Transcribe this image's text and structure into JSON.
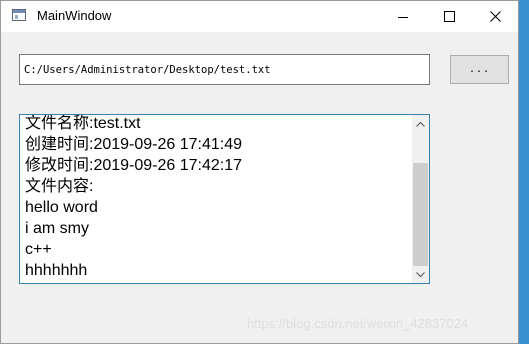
{
  "window": {
    "title": "MainWindow",
    "controls": [
      "minimize-icon",
      "maximize-icon",
      "close-icon"
    ]
  },
  "path_input": {
    "value": "C:/Users/Administrator/Desktop/test.txt"
  },
  "browse_button": {
    "label": "..."
  },
  "file_info": {
    "lines": [
      "文件名称:test.txt",
      "创建时间:2019-09-26 17:41:49",
      "修改时间:2019-09-26 17:42:17",
      "文件内容:",
      "hello word",
      "i am smy",
      "c++",
      "hhhhhhh"
    ]
  },
  "scrollbar": {
    "position_fraction": 0.85
  },
  "watermark": "https://blog.csdn.net/weixin_42837024",
  "colors": {
    "desktop": "#3a8fd0",
    "window_bg": "#f0f0f0",
    "focus_border": "#3c7fb1",
    "button_bg": "#e1e1e1"
  }
}
